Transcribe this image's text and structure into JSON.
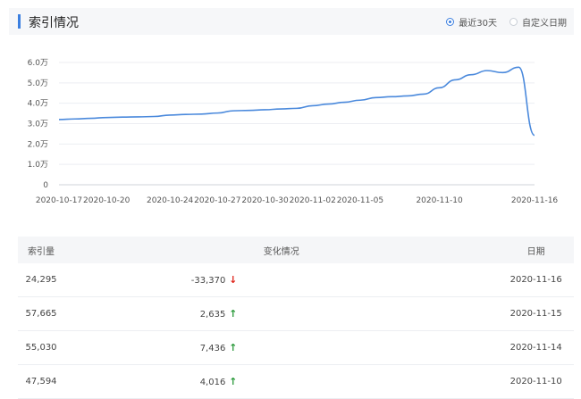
{
  "header": {
    "title": "索引情况",
    "options": [
      {
        "label": "最近30天",
        "checked": true
      },
      {
        "label": "自定义日期",
        "checked": false
      }
    ]
  },
  "chart_data": {
    "type": "line",
    "y_ticks": [
      "6.0万",
      "5.0万",
      "4.0万",
      "3.0万",
      "2.0万",
      "1.0万",
      "0"
    ],
    "x_ticks": [
      "2020-10-17",
      "2020-10-20",
      "2020-10-24",
      "2020-10-27",
      "2020-10-30",
      "2020-11-02",
      "2020-11-05",
      "2020-11-10",
      "2020-11-16"
    ],
    "ylim": [
      0,
      60000
    ],
    "grid": true,
    "series": [
      {
        "color": "#4a89dc",
        "points": [
          [
            "2020-10-17",
            32000
          ],
          [
            "2020-10-18",
            32300
          ],
          [
            "2020-10-19",
            32600
          ],
          [
            "2020-10-20",
            33000
          ],
          [
            "2020-10-21",
            33200
          ],
          [
            "2020-10-22",
            33300
          ],
          [
            "2020-10-23",
            33500
          ],
          [
            "2020-10-24",
            34200
          ],
          [
            "2020-10-25",
            34500
          ],
          [
            "2020-10-26",
            34700
          ],
          [
            "2020-10-27",
            35200
          ],
          [
            "2020-10-28",
            36300
          ],
          [
            "2020-10-29",
            36500
          ],
          [
            "2020-10-30",
            36800
          ],
          [
            "2020-10-31",
            37200
          ],
          [
            "2020-11-01",
            37500
          ],
          [
            "2020-11-02",
            38800
          ],
          [
            "2020-11-03",
            39600
          ],
          [
            "2020-11-04",
            40500
          ],
          [
            "2020-11-05",
            41500
          ],
          [
            "2020-11-06",
            42800
          ],
          [
            "2020-11-07",
            43200
          ],
          [
            "2020-11-08",
            43600
          ],
          [
            "2020-11-09",
            44500
          ],
          [
            "2020-11-10",
            47594
          ],
          [
            "2020-11-11",
            51500
          ],
          [
            "2020-11-12",
            54000
          ],
          [
            "2020-11-13",
            56000
          ],
          [
            "2020-11-14",
            55030
          ],
          [
            "2020-11-15",
            57665
          ],
          [
            "2020-11-16",
            24295
          ]
        ]
      }
    ]
  },
  "table": {
    "headers": [
      "索引量",
      "变化情况",
      "日期"
    ],
    "rows": [
      {
        "count": "24,295",
        "change": "-33,370",
        "dir": "down",
        "date": "2020-11-16"
      },
      {
        "count": "57,665",
        "change": "2,635",
        "dir": "up",
        "date": "2020-11-15"
      },
      {
        "count": "55,030",
        "change": "7,436",
        "dir": "up",
        "date": "2020-11-14"
      },
      {
        "count": "47,594",
        "change": "4,016",
        "dir": "up",
        "date": "2020-11-10"
      }
    ]
  },
  "colors": {
    "accent": "#3b7fe0",
    "line": "#4a89dc",
    "down": "#e0251b",
    "up": "#2b9a3b"
  }
}
